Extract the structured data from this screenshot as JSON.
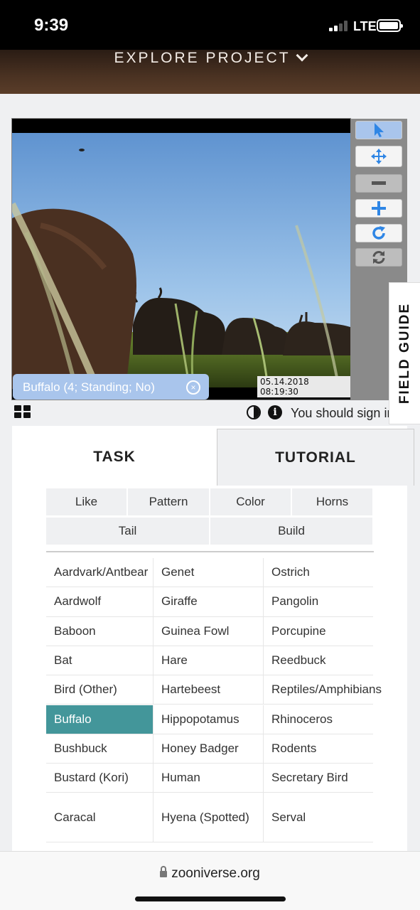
{
  "status_bar": {
    "time": "9:39",
    "network": "LTE"
  },
  "header": {
    "nav_label": "EXPLORE PROJECT"
  },
  "subject": {
    "timestamp": "05.14.2018 08:19:30",
    "annotation_label": "Buffalo (4; Standing; No)",
    "annotation_remove_symbol": "×"
  },
  "toolbar": {
    "tools": [
      {
        "name": "select",
        "icon": "cursor-pointer-icon",
        "state": "active"
      },
      {
        "name": "pan",
        "icon": "move-arrows-icon",
        "state": "normal"
      },
      {
        "name": "zoom-out",
        "icon": "minus-icon",
        "state": "disabled"
      },
      {
        "name": "zoom-in",
        "icon": "plus-icon",
        "state": "normal"
      },
      {
        "name": "rotate",
        "icon": "rotate-icon",
        "state": "normal"
      },
      {
        "name": "reset",
        "icon": "refresh-icon",
        "state": "disabled"
      }
    ],
    "accent_color": "#2f86e5"
  },
  "field_guide": {
    "label": "FIELD GUIDE"
  },
  "image_controls": {
    "info_symbol": "i",
    "sign_in_text": "You should sign in"
  },
  "task_panel": {
    "tabs": [
      {
        "label": "TASK",
        "active": true
      },
      {
        "label": "TUTORIAL",
        "active": false
      }
    ],
    "filters": [
      "Like",
      "Pattern",
      "Color",
      "Horns",
      "Tail",
      "Build"
    ],
    "species_columns": [
      [
        "Aardvark/Antbear",
        "Aardwolf",
        "Baboon",
        "Bat",
        "Bird (Other)",
        "Buffalo",
        "Bushbuck",
        "Bustard (Kori)",
        "Caracal"
      ],
      [
        "Genet",
        "Giraffe",
        "Guinea Fowl",
        "Hare",
        "Hartebeest",
        "Hippopotamus",
        "Honey Badger",
        "Human",
        "Hyena (Spotted)"
      ],
      [
        "Ostrich",
        "Pangolin",
        "Porcupine",
        "Reedbuck",
        "Reptiles/Amphibians",
        "Rhinoceros",
        "Rodents",
        "Secretary Bird",
        "Serval"
      ]
    ],
    "selected_species": "Buffalo",
    "selected_color": "#43969a"
  },
  "browser": {
    "url": "zooniverse.org"
  }
}
